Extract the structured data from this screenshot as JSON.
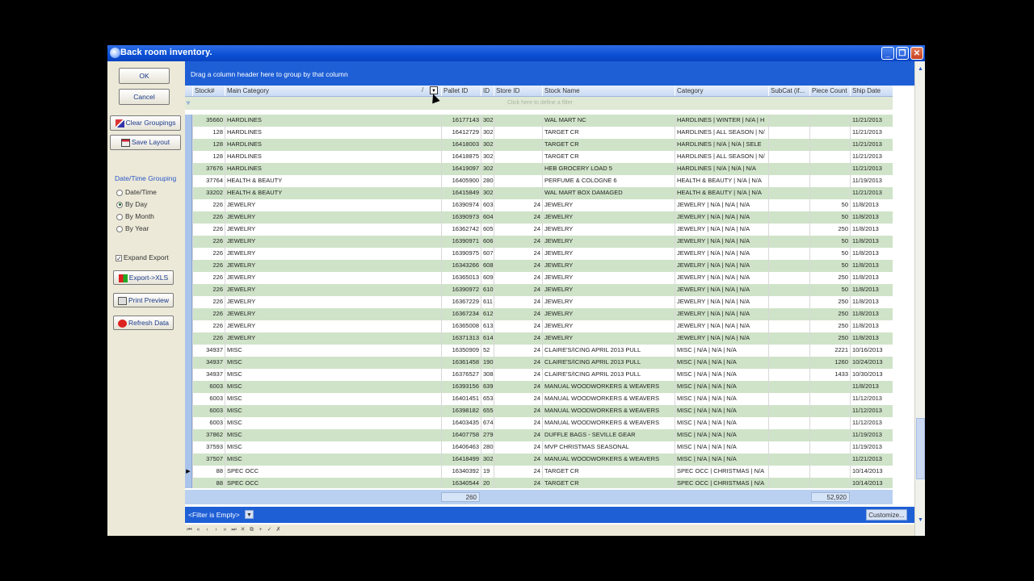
{
  "window": {
    "title": "Back room inventory."
  },
  "left": {
    "ok": "OK",
    "cancel": "Cancel",
    "clear_groupings": "Clear Groupings",
    "save_layout": "Save Layout",
    "grouping_title": "Date/Time Grouping",
    "radios": [
      "Date/Time",
      "By Day",
      "By Month",
      "By Year"
    ],
    "radio_selected": "By Day",
    "expand_export": "Expand Export",
    "expand_export_checked": true,
    "export_xls": "Export->XLS",
    "print_preview": "Print Preview",
    "refresh_data": "Refresh Data"
  },
  "grid": {
    "group_hint": "Drag a column header here to group by that column",
    "filter_hint": "Click here to define a filter",
    "columns": [
      "Stock#",
      "Main Category",
      "Pallet ID",
      "ID",
      "Store ID",
      "Stock Name",
      "Category",
      "SubCat (if...",
      "Piece Count",
      "Ship Date"
    ],
    "rows": [
      [
        "35660",
        "HARDLINES",
        "16177143",
        "302",
        "",
        "WAL MART NC",
        "HARDLINES | WINTER | N/A | H",
        "",
        "",
        "11/21/2013"
      ],
      [
        "128",
        "HARDLINES",
        "16412729",
        "302",
        "",
        "TARGET CR",
        "HARDLINES | ALL SEASON | N/",
        "",
        "",
        "11/21/2013"
      ],
      [
        "128",
        "HARDLINES",
        "16418003",
        "302",
        "",
        "TARGET CR",
        "HARDLINES | N/A | N/A | SELE",
        "",
        "",
        "11/21/2013"
      ],
      [
        "128",
        "HARDLINES",
        "16418875",
        "302",
        "",
        "TARGET CR",
        "HARDLINES | ALL SEASON | N/",
        "",
        "",
        "11/21/2013"
      ],
      [
        "37676",
        "HARDLINES",
        "16419097",
        "302",
        "",
        "HEB GROCERY LOAD 5",
        "HARDLINES | N/A | N/A | N/A",
        "",
        "",
        "11/21/2013"
      ],
      [
        "37764",
        "HEALTH & BEAUTY",
        "16405900",
        "280",
        "",
        "PERFUME & COLOGNE 6",
        "HEALTH & BEAUTY | N/A | N/A",
        "",
        "",
        "11/19/2013"
      ],
      [
        "33202",
        "HEALTH & BEAUTY",
        "16415849",
        "302",
        "",
        "WAL MART BOX DAMAGED",
        "HEALTH & BEAUTY | N/A | N/A",
        "",
        "",
        "11/21/2013"
      ],
      [
        "226",
        "JEWELRY",
        "16390974",
        "603",
        "24",
        "JEWELRY",
        "JEWELRY | N/A | N/A | N/A",
        "",
        "50",
        "11/8/2013"
      ],
      [
        "226",
        "JEWELRY",
        "16390973",
        "604",
        "24",
        "JEWELRY",
        "JEWELRY | N/A | N/A | N/A",
        "",
        "50",
        "11/8/2013"
      ],
      [
        "226",
        "JEWELRY",
        "16362742",
        "605",
        "24",
        "JEWELRY",
        "JEWELRY | N/A | N/A | N/A",
        "",
        "250",
        "11/8/2013"
      ],
      [
        "226",
        "JEWELRY",
        "16390971",
        "606",
        "24",
        "JEWELRY",
        "JEWELRY | N/A | N/A | N/A",
        "",
        "50",
        "11/8/2013"
      ],
      [
        "226",
        "JEWELRY",
        "16390975",
        "607",
        "24",
        "JEWELRY",
        "JEWELRY | N/A | N/A | N/A",
        "",
        "50",
        "11/8/2013"
      ],
      [
        "226",
        "JEWELRY",
        "16343266",
        "608",
        "24",
        "JEWELRY",
        "JEWELRY | N/A | N/A | N/A",
        "",
        "50",
        "11/8/2013"
      ],
      [
        "226",
        "JEWELRY",
        "16365013",
        "609",
        "24",
        "JEWELRY",
        "JEWELRY | N/A | N/A | N/A",
        "",
        "250",
        "11/8/2013"
      ],
      [
        "226",
        "JEWELRY",
        "16390972",
        "610",
        "24",
        "JEWELRY",
        "JEWELRY | N/A | N/A | N/A",
        "",
        "50",
        "11/8/2013"
      ],
      [
        "226",
        "JEWELRY",
        "16367229",
        "611",
        "24",
        "JEWELRY",
        "JEWELRY | N/A | N/A | N/A",
        "",
        "250",
        "11/8/2013"
      ],
      [
        "226",
        "JEWELRY",
        "16367234",
        "612",
        "24",
        "JEWELRY",
        "JEWELRY | N/A | N/A | N/A",
        "",
        "250",
        "11/8/2013"
      ],
      [
        "226",
        "JEWELRY",
        "16365008",
        "613",
        "24",
        "JEWELRY",
        "JEWELRY | N/A | N/A | N/A",
        "",
        "250",
        "11/8/2013"
      ],
      [
        "226",
        "JEWELRY",
        "16371313",
        "614",
        "24",
        "JEWELRY",
        "JEWELRY | N/A | N/A | N/A",
        "",
        "250",
        "11/8/2013"
      ],
      [
        "34937",
        "MISC",
        "16350909",
        "52",
        "24",
        "CLAIRE'S/ICING APRIL 2013 PULL",
        "MISC | N/A | N/A | N/A",
        "",
        "2221",
        "10/16/2013"
      ],
      [
        "34937",
        "MISC",
        "16361458",
        "190",
        "24",
        "CLAIRE'S/ICING APRIL 2013 PULL",
        "MISC | N/A | N/A | N/A",
        "",
        "1260",
        "10/24/2013"
      ],
      [
        "34937",
        "MISC",
        "16376527",
        "308",
        "24",
        "CLAIRE'S/ICING APRIL 2013 PULL",
        "MISC | N/A | N/A | N/A",
        "",
        "1433",
        "10/30/2013"
      ],
      [
        "6003",
        "MISC",
        "16393156",
        "639",
        "24",
        "MANUAL WOODWORKERS & WEAVERS",
        "MISC | N/A | N/A | N/A",
        "",
        "",
        "11/8/2013"
      ],
      [
        "6003",
        "MISC",
        "16401451",
        "653",
        "24",
        "MANUAL WOODWORKERS & WEAVERS",
        "MISC | N/A | N/A | N/A",
        "",
        "",
        "11/12/2013"
      ],
      [
        "6003",
        "MISC",
        "16398182",
        "655",
        "24",
        "MANUAL WOODWORKERS & WEAVERS",
        "MISC | N/A | N/A | N/A",
        "",
        "",
        "11/12/2013"
      ],
      [
        "6003",
        "MISC",
        "16403435",
        "674",
        "24",
        "MANUAL WOODWORKERS & WEAVERS",
        "MISC | N/A | N/A | N/A",
        "",
        "",
        "11/12/2013"
      ],
      [
        "37862",
        "MISC",
        "16407758",
        "279",
        "24",
        "DUFFLE BAGS - SEVILLE GEAR",
        "MISC | N/A | N/A | N/A",
        "",
        "",
        "11/19/2013"
      ],
      [
        "37593",
        "MISC",
        "16406463",
        "280",
        "24",
        "MVP CHRISTMAS SEASONAL",
        "MISC | N/A | N/A | N/A",
        "",
        "",
        "11/19/2013"
      ],
      [
        "37507",
        "MISC",
        "16418499",
        "302",
        "24",
        "MANUAL WOODWORKERS & WEAVERS",
        "MISC | N/A | N/A | N/A",
        "",
        "",
        "11/21/2013"
      ],
      [
        "88",
        "SPEC OCC",
        "16340392",
        "19",
        "24",
        "TARGET CR",
        "SPEC OCC | CHRISTMAS | N/A",
        "",
        "",
        "10/14/2013"
      ],
      [
        "88",
        "SPEC OCC",
        "16340544",
        "20",
        "24",
        "TARGET CR",
        "SPEC OCC | CHRISTMAS | N/A",
        "",
        "",
        "10/14/2013"
      ]
    ],
    "current_row": 29,
    "totals": {
      "pallet_count": "260",
      "piece_total": "52,920"
    },
    "filter_empty": "<Filter is Empty>",
    "customize": "Customize...",
    "nav_glyphs": [
      "⏮",
      "«",
      "‹",
      "›",
      "»",
      "⏭",
      "✕",
      "⧉",
      "+",
      "✓",
      "✗"
    ]
  }
}
